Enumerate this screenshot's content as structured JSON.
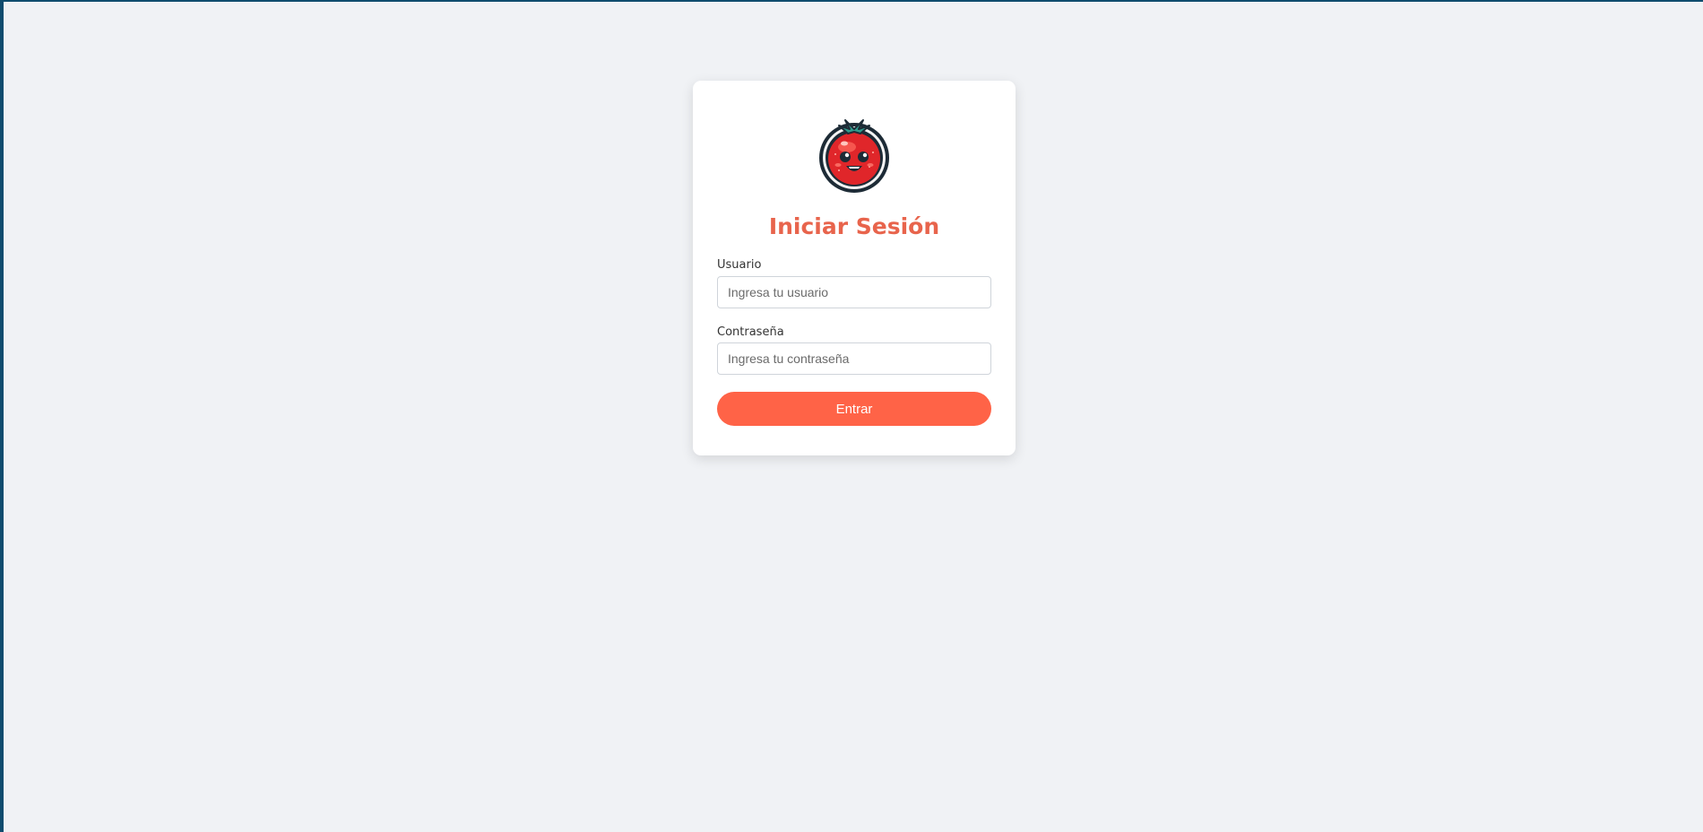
{
  "login": {
    "title": "Iniciar Sesión",
    "username_label": "Usuario",
    "username_placeholder": "Ingresa tu usuario",
    "username_value": "",
    "password_label": "Contraseña",
    "password_placeholder": "Ingresa tu contraseña",
    "password_value": "",
    "submit_label": "Entrar",
    "logo_icon": "tomato-mascot-icon"
  },
  "colors": {
    "page_background": "#f0f2f5",
    "window_frame": "#0f4c6e",
    "card_background": "#ffffff",
    "title": "#e8644c",
    "button": "#ff6347",
    "button_text": "#ffffff",
    "input_border": "#cfd4da"
  }
}
